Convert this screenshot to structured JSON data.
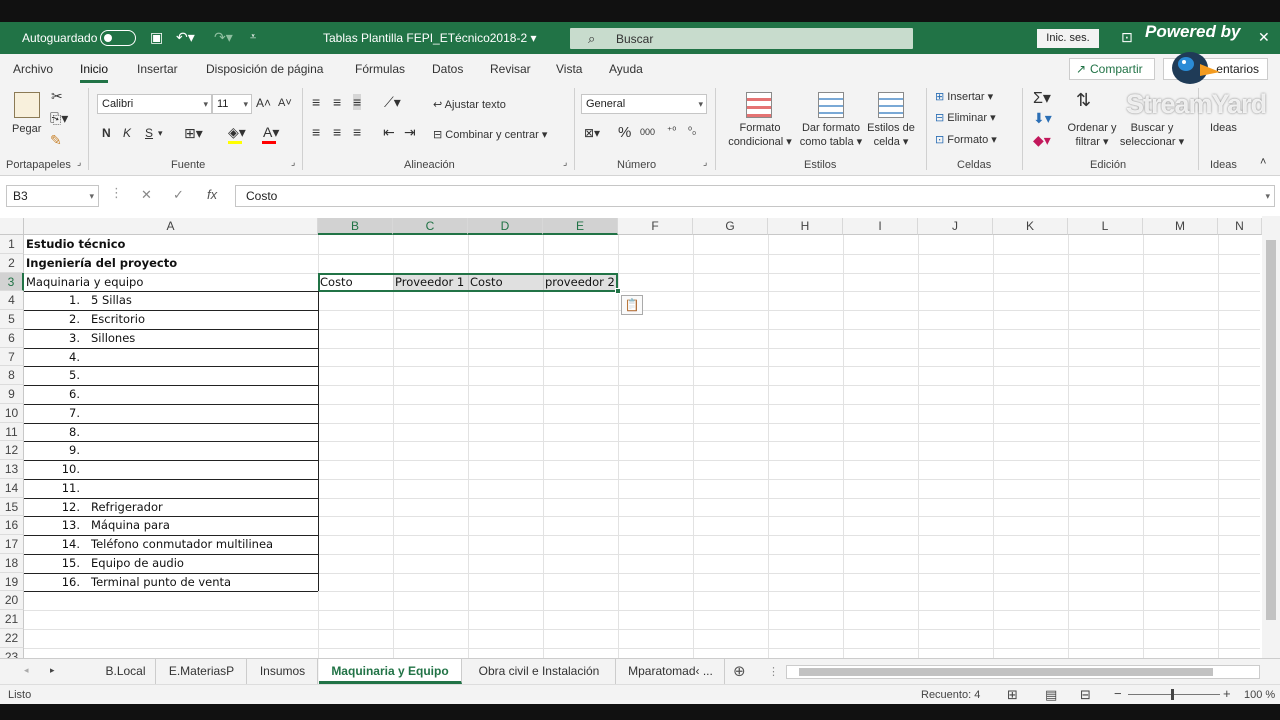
{
  "titlebar": {
    "autosave_label": "Autoguardado",
    "doc_title": "Tablas Plantilla FEPI_ETécnico2018-2",
    "search_placeholder": "Buscar",
    "signin_label": "Inic. ses.",
    "powered_by": "Powered by"
  },
  "tabs": [
    "Archivo",
    "Inicio",
    "Insertar",
    "Disposición de página",
    "Fórmulas",
    "Datos",
    "Revisar",
    "Vista",
    "Ayuda"
  ],
  "share_label": "Compartir",
  "comments_label": "entarios",
  "ribbon": {
    "portapapeles": {
      "label": "Portapapeles",
      "paste": "Pegar"
    },
    "fuente": {
      "label": "Fuente",
      "font": "Calibri",
      "size": "11",
      "bold": "N",
      "italic": "K",
      "underline": "S"
    },
    "alineacion": {
      "label": "Alineación",
      "wrap": "Ajustar texto",
      "merge": "Combinar y centrar"
    },
    "numero": {
      "label": "Número",
      "format": "General",
      "percent": "%",
      "thousands": "000"
    },
    "estilos": {
      "label": "Estilos",
      "cond1": "Formato",
      "cond2": "condicional",
      "table1": "Dar formato",
      "table2": "como tabla",
      "cell1": "Estilos de",
      "cell2": "celda"
    },
    "celdas": {
      "label": "Celdas",
      "insert": "Insertar",
      "delete": "Eliminar",
      "format": "Formato"
    },
    "edicion": {
      "label": "Edición",
      "sort1": "Ordenar y",
      "sort2": "filtrar",
      "find1": "Buscar y",
      "find2": "seleccionar"
    },
    "ideas": {
      "label": "Ideas",
      "btn": "Ideas"
    }
  },
  "formula_bar": {
    "name_box": "B3",
    "fx": "fx",
    "content": "Costo"
  },
  "columns": [
    "A",
    "B",
    "C",
    "D",
    "E",
    "F",
    "G",
    "H",
    "I",
    "J",
    "K",
    "L",
    "M",
    "N"
  ],
  "rows": [
    "1",
    "2",
    "3",
    "4",
    "5",
    "6",
    "7",
    "8",
    "9",
    "10",
    "11",
    "12",
    "13",
    "14",
    "15",
    "16",
    "17",
    "18",
    "19",
    "20",
    "21",
    "22",
    "23"
  ],
  "cells": {
    "A1": "Estudio técnico",
    "A2": "Ingeniería del proyecto",
    "A3": "Maquinaria y equipo",
    "B3": "Costo",
    "C3": "Proveedor 1",
    "D3": "Costo",
    "E3": "proveedor 2",
    "list": [
      {
        "n": "1.",
        "t": "5 Sillas"
      },
      {
        "n": "2.",
        "t": "Escritorio"
      },
      {
        "n": "3.",
        "t": "Sillones"
      },
      {
        "n": "4.",
        "t": ""
      },
      {
        "n": "5.",
        "t": ""
      },
      {
        "n": "6.",
        "t": ""
      },
      {
        "n": "7.",
        "t": ""
      },
      {
        "n": "8.",
        "t": ""
      },
      {
        "n": "9.",
        "t": ""
      },
      {
        "n": "10.",
        "t": ""
      },
      {
        "n": "11.",
        "t": ""
      },
      {
        "n": "12.",
        "t": "Refrigerador"
      },
      {
        "n": "13.",
        "t": "Máquina para"
      },
      {
        "n": "14.",
        "t": "Teléfono conmutador multilinea"
      },
      {
        "n": "15.",
        "t": "Equipo de audio"
      },
      {
        "n": "16.",
        "t": "Terminal punto de venta"
      }
    ]
  },
  "sheet_tabs": [
    "B.Local",
    "E.MateriasP",
    "Insumos",
    "Maquinaria y Equipo",
    "Obra civil e Instalación",
    "Mparatomad‹ ..."
  ],
  "active_sheet": "Maquinaria y Equipo",
  "status": {
    "ready": "Listo",
    "count": "Recuento: 4",
    "zoom": "100 %"
  },
  "watermark": "StreamYard"
}
